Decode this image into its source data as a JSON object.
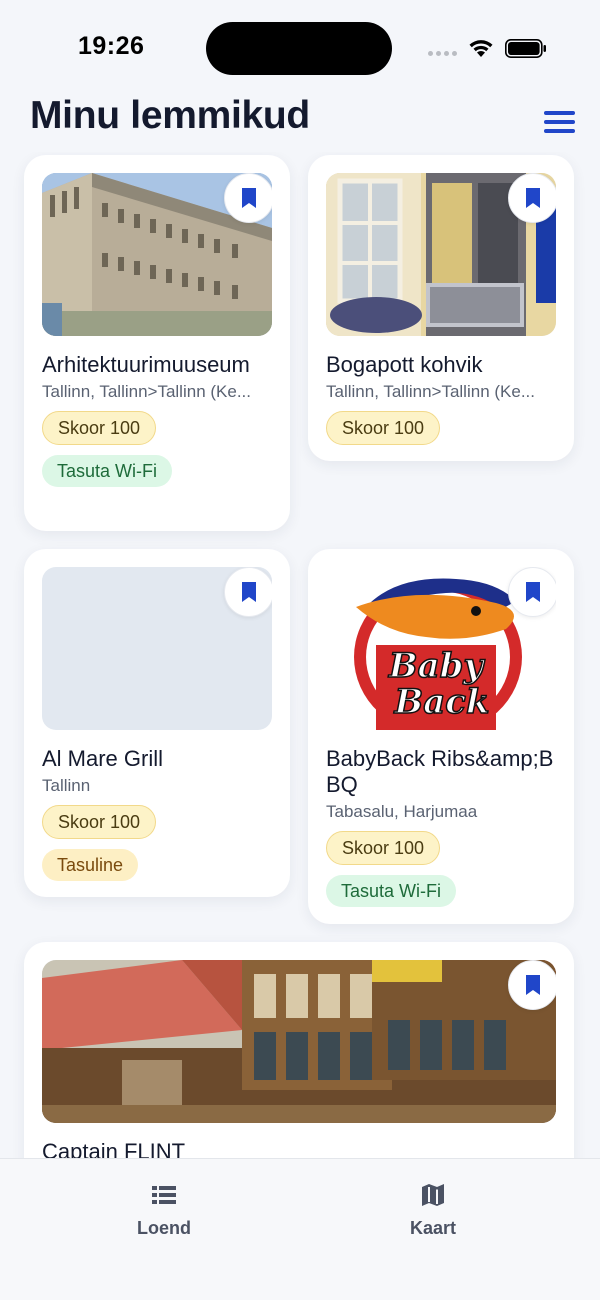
{
  "status_bar": {
    "time": "19:26"
  },
  "header": {
    "title": "Minu lemmikud",
    "menu_icon": "hamburger-menu-icon"
  },
  "colors": {
    "accent": "#2046c9",
    "score_chip": "#fdf3c8",
    "wifi_chip": "#dcf7e6",
    "paid_chip": "#fdefc4"
  },
  "cards": [
    {
      "title": "Arhitektuurimuuseum",
      "subtitle": "Tallinn, Tallinn>Tallinn (Ke...",
      "score": "Skoor 100",
      "tag": "Tasuta Wi-Fi",
      "bookmark_icon": "bookmark-icon"
    },
    {
      "title": "Bogapott kohvik",
      "subtitle": "Tallinn, Tallinn>Tallinn (Ke...",
      "score": "Skoor 100",
      "bookmark_icon": "bookmark-icon"
    },
    {
      "title": "Al Mare Grill",
      "subtitle": "Tallinn",
      "score": "Skoor 100",
      "tag": "Tasuline",
      "bookmark_icon": "bookmark-icon"
    },
    {
      "title": "BabyBack Ribs&amp;BBQ",
      "subtitle": "Tabasalu, Harjumaa",
      "score": "Skoor 100",
      "tag": "Tasuta Wi-Fi",
      "bookmark_icon": "bookmark-icon",
      "logo_text": [
        "Baby",
        "Back"
      ]
    },
    {
      "title": "Captain FLINT",
      "bookmark_icon": "bookmark-icon"
    }
  ],
  "tab_bar": {
    "tabs": [
      {
        "label": "Loend",
        "icon": "list-icon"
      },
      {
        "label": "Kaart",
        "icon": "map-icon"
      }
    ]
  }
}
